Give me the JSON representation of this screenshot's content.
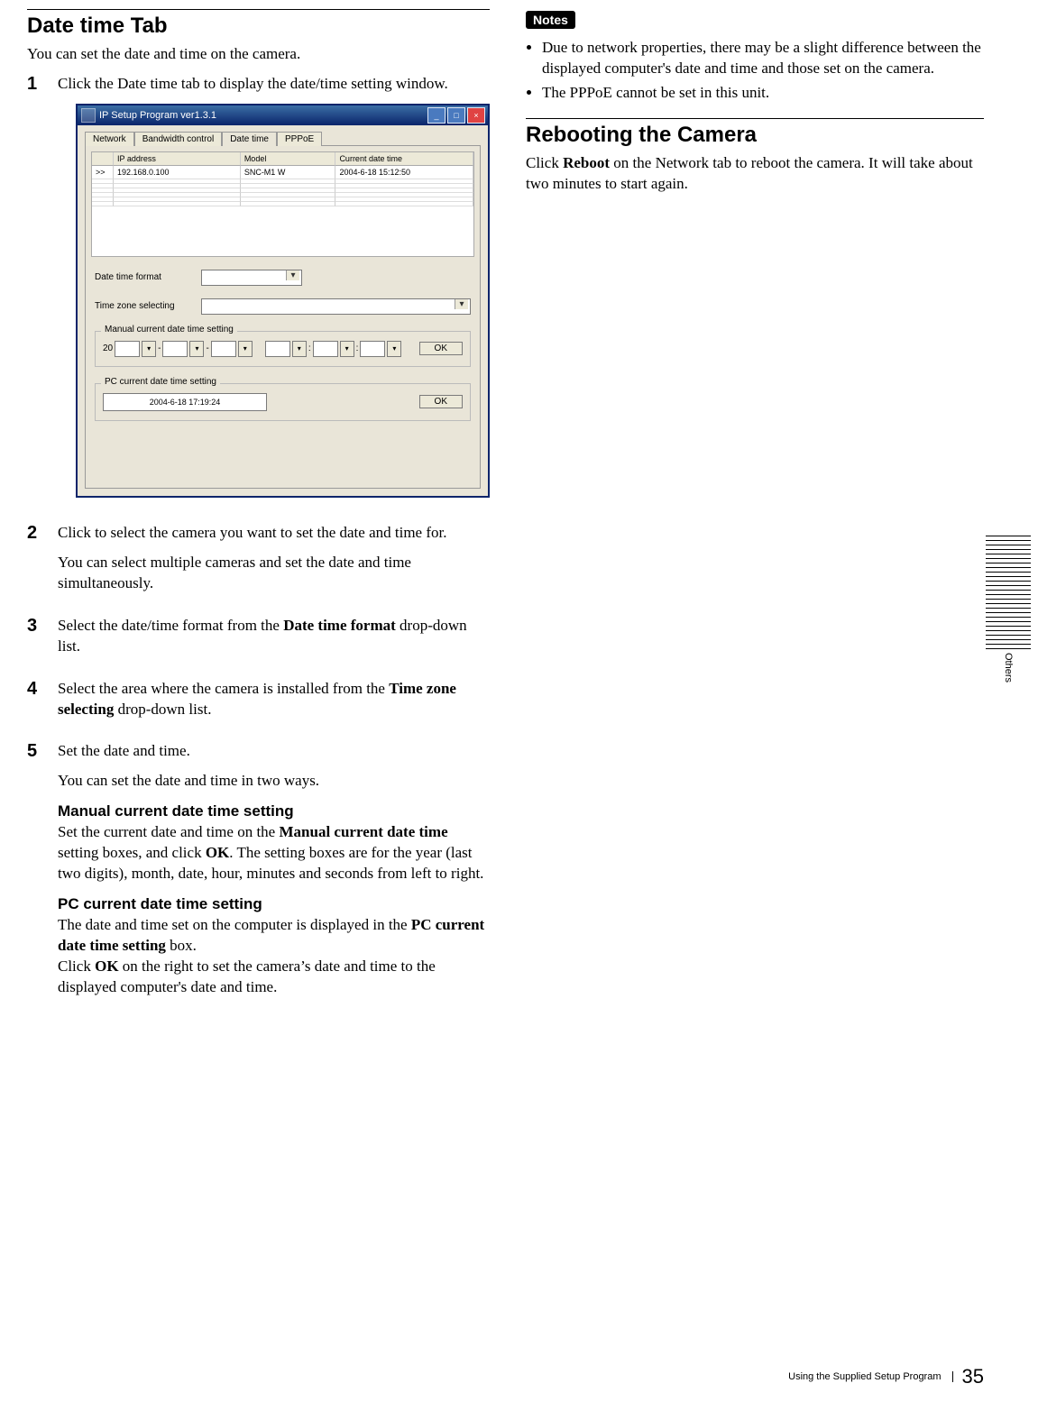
{
  "left": {
    "heading": "Date time Tab",
    "intro": "You can set the date and time on the camera.",
    "steps": {
      "s1": {
        "num": "1",
        "text": "Click the Date time tab to display the date/time setting window."
      },
      "s2": {
        "num": "2",
        "text": "Click to select the camera you want to set the date and time for.",
        "para": "You can select multiple cameras and set the date and time simultaneously."
      },
      "s3": {
        "num": "3",
        "text_prefix": "Select the date/time format from the ",
        "bold": "Date time format",
        "text_suffix": " drop-down list."
      },
      "s4": {
        "num": "4",
        "text_prefix": "Select the area where the camera is installed from the ",
        "bold": "Time zone selecting",
        "text_suffix": " drop-down list."
      },
      "s5": {
        "num": "5",
        "text": "Set the date and time.",
        "para": "You can set the date and time in two ways.",
        "manual_head": "Manual current date time setting",
        "manual_p_a": "Set the current date and time on the ",
        "manual_p_b": "Manual current date time",
        "manual_p_c": " setting boxes, and click ",
        "manual_p_d": "OK",
        "manual_p_e": ". The setting boxes are for the year (last two digits), month, date, hour, minutes and seconds from left to right.",
        "pc_head": "PC current date time setting",
        "pc_p_a": "The date and time set on the computer is displayed in the ",
        "pc_p_b": "PC current date time setting",
        "pc_p_c": " box.",
        "pc_p_d": "Click ",
        "pc_p_e": "OK",
        "pc_p_f": " on the right to set the camera’s date and time to the displayed computer's date and time."
      }
    }
  },
  "shot": {
    "title": "IP Setup Program ver1.3.1",
    "tabs": {
      "network": "Network",
      "bandwidth": "Bandwidth control",
      "datetime": "Date time",
      "pppoe": "PPPoE"
    },
    "grid_head": {
      "c1": "",
      "c2": "IP address",
      "c3": "Model",
      "c4": "Current date time"
    },
    "grid_row": {
      "c1": ">>",
      "c2": "192.168.0.100",
      "c3": "SNC-M1 W",
      "c4": "2004-6-18  15:12:50"
    },
    "labels": {
      "date_time_format": "Date time format",
      "time_zone": "Time zone selecting",
      "manual_group": "Manual current date time setting",
      "pc_group": "PC current date time setting",
      "year_prefix": "20",
      "ok": "OK",
      "pc_value": "2004-6-18     17:19:24"
    }
  },
  "right": {
    "notes_label": "Notes",
    "note1": "Due to network properties, there may be a slight difference between the displayed computer's date and time and those set on the camera.",
    "note2": "The PPPoE cannot be set in this unit.",
    "reboot_heading": "Rebooting the Camera",
    "reboot_p_a": "Click ",
    "reboot_p_b": "Reboot",
    "reboot_p_c": " on the Network tab to reboot the camera. It will take about two minutes to start again."
  },
  "side_label": "Others",
  "footer": {
    "title": "Using the Supplied Setup Program",
    "page": "35"
  }
}
